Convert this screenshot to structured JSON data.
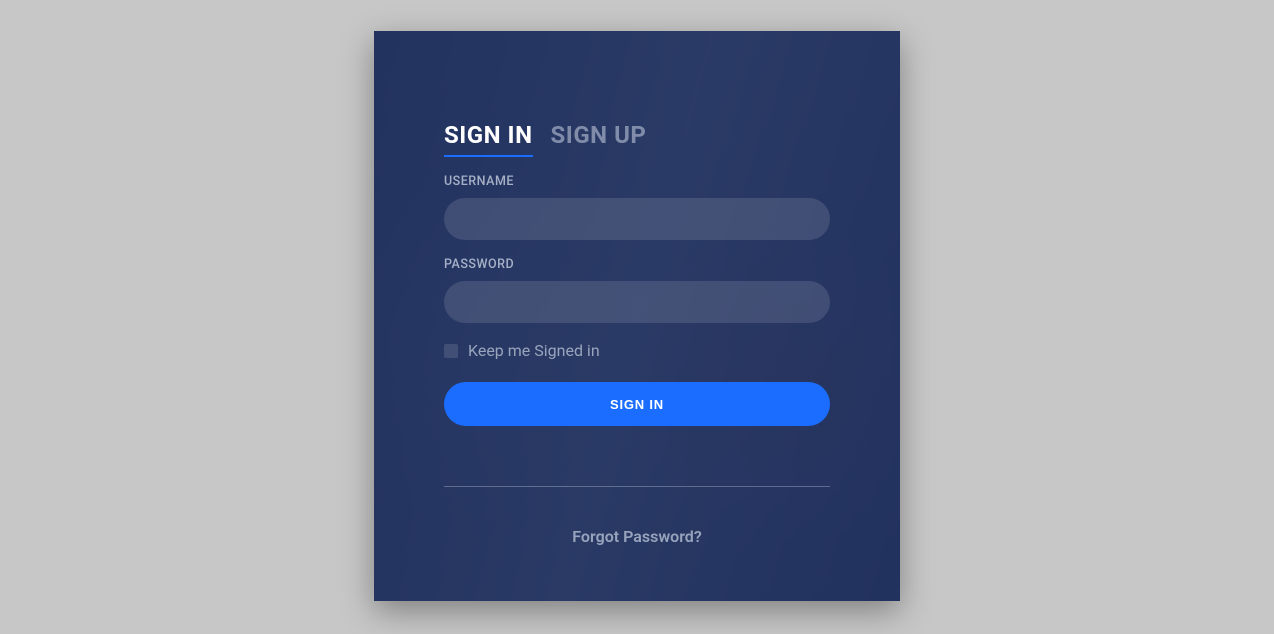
{
  "tabs": {
    "signin": "SIGN IN",
    "signup": "SIGN UP"
  },
  "form": {
    "username_label": "USERNAME",
    "username_value": "",
    "password_label": "PASSWORD",
    "password_value": "",
    "keep_signed_in_label": "Keep me Signed in",
    "submit_label": "SIGN IN"
  },
  "links": {
    "forgot_password": "Forgot Password?"
  },
  "colors": {
    "accent": "#1a6dff",
    "overlay": "rgba(29,46,95,0.82)"
  }
}
